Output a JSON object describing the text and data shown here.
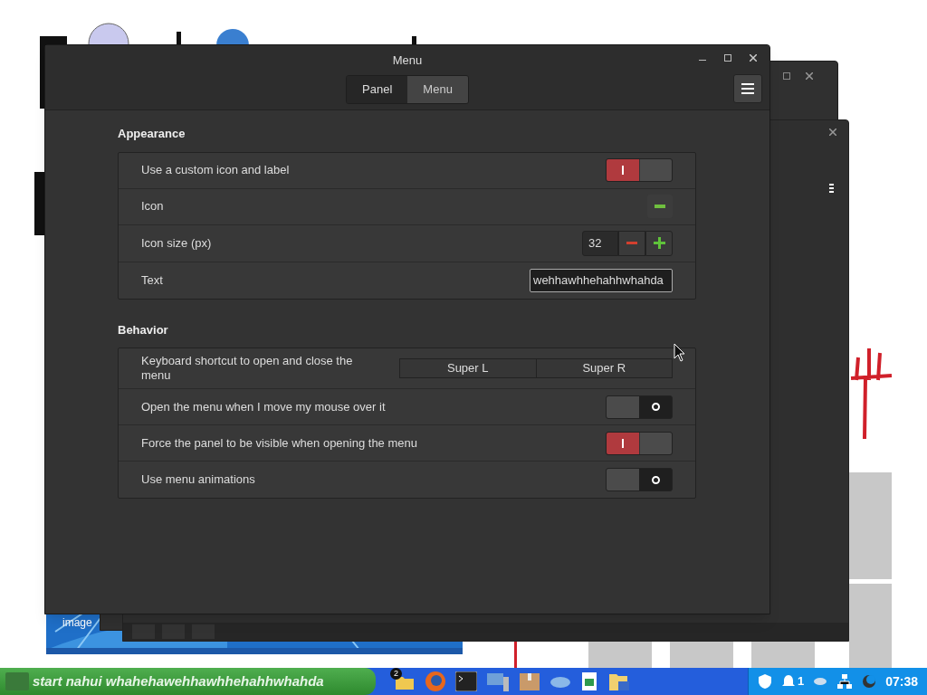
{
  "main_window": {
    "title": "Menu",
    "tabs": [
      {
        "label": "Panel",
        "selected": true
      },
      {
        "label": "Menu",
        "selected": false
      }
    ],
    "sections": [
      {
        "title": "Appearance",
        "rows": [
          {
            "kind": "switch",
            "label": "Use a custom icon and label",
            "on": true
          },
          {
            "kind": "icon",
            "label": "Icon"
          },
          {
            "kind": "spin",
            "label": "Icon size (px)",
            "value": "32"
          },
          {
            "kind": "entry",
            "label": "Text",
            "value": "wehhawhhehahhwhahda"
          }
        ]
      },
      {
        "title": "Behavior",
        "rows": [
          {
            "kind": "keys",
            "label": "Keyboard shortcut to open and close the menu",
            "keys": [
              "Super L",
              "Super R"
            ]
          },
          {
            "kind": "switch",
            "label": "Open the menu when I move my mouse over it",
            "on": false
          },
          {
            "kind": "switch",
            "label": "Force the panel to be visible when opening the menu",
            "on": true
          },
          {
            "kind": "switch",
            "label": "Use menu animations",
            "on": false
          }
        ]
      }
    ]
  },
  "desktop": {
    "image_label": "image"
  },
  "taskbar": {
    "start_label": "start nahui whahehawehhawhhehahhwhahda",
    "folder_badge": "2",
    "notification_count": "1",
    "clock": "07:38"
  }
}
